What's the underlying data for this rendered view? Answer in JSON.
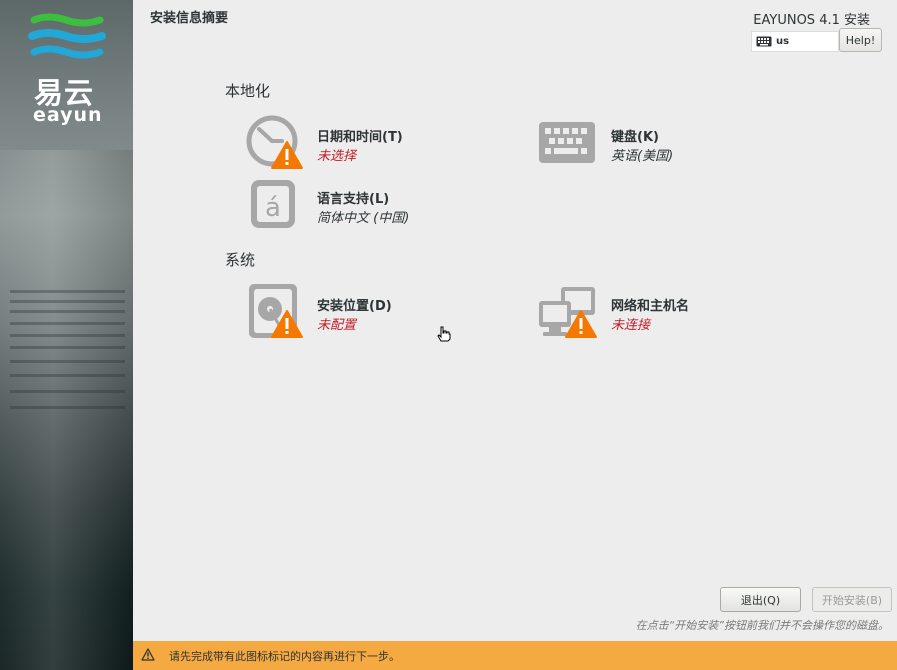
{
  "sidebar": {
    "logo_cn": "易云",
    "logo_en": "eayun"
  },
  "header": {
    "title": "安装信息摘要",
    "product": "EAYUNOS 4.1 安装",
    "keyboard_layout": "us",
    "help_label": "Help!"
  },
  "sections": {
    "localization": {
      "title": "本地化",
      "datetime": {
        "name": "日期和时间(T)",
        "status": "未选择"
      },
      "keyboard": {
        "name": "键盘(K)",
        "status": "英语(美国)"
      },
      "language": {
        "name": "语言支持(L)",
        "status": "简体中文 (中国)"
      }
    },
    "system": {
      "title": "系统",
      "destination": {
        "name": "安装位置(D)",
        "status": "未配置"
      },
      "network": {
        "name": "网络和主机名",
        "status": "未连接"
      }
    }
  },
  "footer": {
    "quit_label": "退出(Q)",
    "begin_label": "开始安装(B)",
    "hint": "在点击“开始安装”按钮前我们并不会操作您的磁盘。"
  },
  "warning_bar": {
    "message": "请先完成带有此图标标记的内容再进行下一步。"
  },
  "colors": {
    "warning": "#f57900",
    "status_error": "#c01c28",
    "warn_bar": "#f5a941",
    "logo_green": "#3cbf3f",
    "logo_cyan": "#22a8d8"
  }
}
